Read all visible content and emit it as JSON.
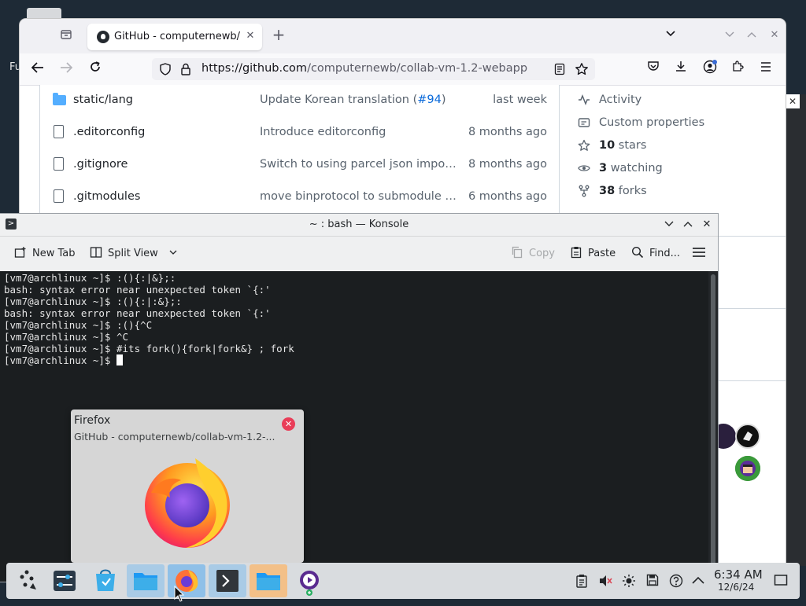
{
  "desktop": {
    "partial_label": "Fu"
  },
  "firefox": {
    "tab_title": "GitHub - computernewb/collab-vm-1.2-webapp",
    "new_tab_symbol": "+",
    "url_domain": "https://github.com",
    "url_path": "/computernewb/collab-vm-1.2-webapp",
    "files": [
      {
        "name": "static/lang",
        "type": "folder",
        "message": "Update Korean translation (",
        "message_link": "#94",
        "message_end": ")",
        "time": "last week"
      },
      {
        "name": ".editorconfig",
        "type": "file",
        "message": "Introduce editorconfig",
        "message_link": "",
        "message_end": "",
        "time": "8 months ago"
      },
      {
        "name": ".gitignore",
        "type": "file",
        "message": "Switch to using parcel json imports…",
        "message_link": "",
        "message_end": "",
        "time": "8 months ago"
      },
      {
        "name": ".gitmodules",
        "type": "file",
        "message": "move binprotocol to submodule (w…",
        "message_link": "",
        "message_end": "",
        "time": "6 months ago"
      }
    ],
    "sidebar": {
      "activity": "Activity",
      "custom_properties": "Custom properties",
      "stars_count": "10",
      "stars_label": " stars",
      "watching_count": "3",
      "watching_label": " watching",
      "forks_count": "38",
      "forks_label": " forks"
    }
  },
  "konsole": {
    "title": "~ : bash — Konsole",
    "toolbar": {
      "new_tab": "New Tab",
      "split_view": "Split View",
      "copy": "Copy",
      "paste": "Paste",
      "find": "Find..."
    },
    "terminal_lines": [
      "[vm7@archlinux ~]$ :(){:|&};:",
      "bash: syntax error near unexpected token `{:'",
      "[vm7@archlinux ~]$ :(){:|:&};:",
      "bash: syntax error near unexpected token `{:'",
      "[vm7@archlinux ~]$ :(){^C",
      "[vm7@archlinux ~]$ ^C",
      "[vm7@archlinux ~]$ #its fork(){fork|fork&} ; fork",
      "[vm7@archlinux ~]$ "
    ]
  },
  "preview": {
    "app": "Firefox",
    "subtitle": "GitHub - computernewb/collab-vm-1.2-..."
  },
  "taskbar": {
    "time": "6:34 AM",
    "date": "12/6/24",
    "apps": [
      "application-launcher-icon",
      "system-settings-icon",
      "discover-icon",
      "file-manager-icon",
      "firefox-icon",
      "konsole-icon",
      "dolphin-icon",
      "media-player-icon"
    ]
  },
  "colors": {
    "accent": "#3daee9",
    "github_link": "#0969da",
    "terminal_bg": "#1b1e20"
  }
}
